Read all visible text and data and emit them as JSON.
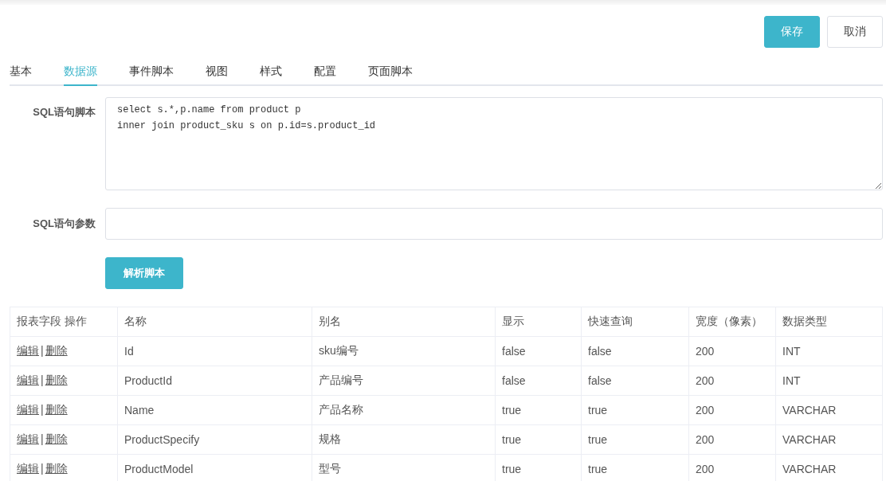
{
  "toolbar": {
    "buttons": [
      {
        "label": "保存",
        "kind": "primary"
      },
      {
        "label": "取消",
        "kind": "default"
      }
    ]
  },
  "tabs": [
    {
      "label": "基本",
      "selected": false
    },
    {
      "label": "数据源",
      "selected": true
    },
    {
      "label": "事件脚本",
      "selected": false
    },
    {
      "label": "视图",
      "selected": false
    },
    {
      "label": "样式",
      "selected": false
    },
    {
      "label": "配置",
      "selected": false
    },
    {
      "label": "页面脚本",
      "selected": false
    }
  ],
  "form": {
    "sql_script": {
      "label": "SQL语句脚本",
      "value": "select s.*,p.name from product p\ninner join product_sku s on p.id=s.product_id"
    },
    "sql_params": {
      "label": "SQL语句参数"
    },
    "parse_button": "解析脚本"
  },
  "table": {
    "columns": [
      "报表字段 操作",
      "名称",
      "别名",
      "显示",
      "快速查询",
      "宽度（像素）",
      "数据类型"
    ],
    "rows": [
      {
        "cells": [
          [
            "编辑",
            "|",
            "删除"
          ],
          "Id",
          "sku编号",
          "false",
          "false",
          "200",
          "INT"
        ]
      },
      {
        "cells": [
          [
            "编辑",
            "|",
            "删除"
          ],
          "ProductId",
          "产品编号",
          "false",
          "false",
          "200",
          "INT"
        ]
      },
      {
        "cells": [
          [
            "编辑",
            "|",
            "删除"
          ],
          "Name",
          "产品名称",
          "true",
          "true",
          "200",
          "VARCHAR"
        ]
      },
      {
        "cells": [
          [
            "编辑",
            "|",
            "删除"
          ],
          "ProductSpecify",
          "规格",
          "true",
          "true",
          "200",
          "VARCHAR"
        ]
      },
      {
        "cells": [
          [
            "编辑",
            "|",
            "删除"
          ],
          "ProductModel",
          "型号",
          "true",
          "true",
          "200",
          "VARCHAR"
        ]
      }
    ]
  }
}
